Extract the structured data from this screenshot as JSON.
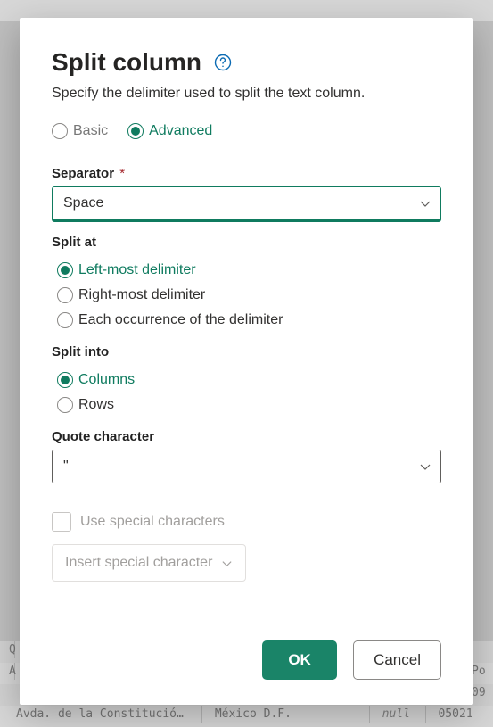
{
  "dialog": {
    "title": "Split column",
    "subtitle": "Specify the delimiter used to split the text column.",
    "mode": {
      "basic_label": "Basic",
      "advanced_label": "Advanced",
      "selected": "advanced"
    },
    "separator": {
      "label": "Separator",
      "required_mark": "*",
      "value": "Space"
    },
    "split_at": {
      "label": "Split at",
      "options": {
        "left": "Left-most delimiter",
        "right": "Right-most delimiter",
        "each": "Each occurrence of the delimiter"
      },
      "selected": "left"
    },
    "split_into": {
      "label": "Split into",
      "options": {
        "columns": "Columns",
        "rows": "Rows"
      },
      "selected": "columns"
    },
    "quote_char": {
      "label": "Quote character",
      "value": "\""
    },
    "special_chars": {
      "checkbox_label": "Use special characters",
      "checked": false,
      "insert_label": "Insert special character"
    },
    "footer": {
      "ok": "OK",
      "cancel": "Cancel"
    }
  },
  "background": {
    "q_label": "Q",
    "row_a": "A",
    "row_po": "Po",
    "row_num": "09",
    "row_text1": "Avda. de la Constitució…",
    "row_text2": "México D.F.",
    "row_null": "null",
    "row_text3": "05021"
  }
}
